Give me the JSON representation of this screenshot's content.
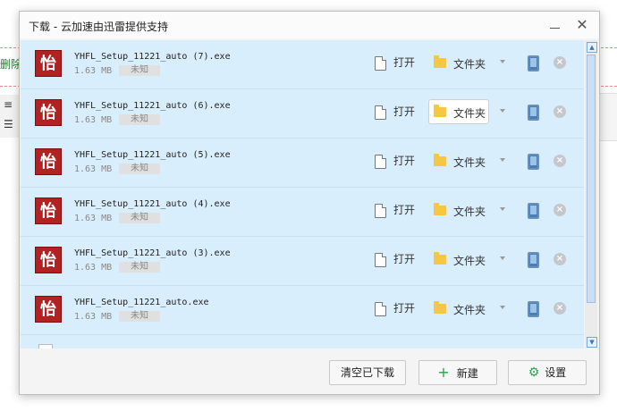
{
  "dialog": {
    "title": "下载 - 云加速由迅雷提供支持"
  },
  "background": {
    "left_label": "删除"
  },
  "downloads": [
    {
      "name": "YHFL_Setup_11221_auto (7).exe",
      "size": "1.63 MB",
      "status": "未知",
      "open": "打开",
      "folder": "文件夹"
    },
    {
      "name": "YHFL_Setup_11221_auto (6).exe",
      "size": "1.63 MB",
      "status": "未知",
      "open": "打开",
      "folder": "文件夹"
    },
    {
      "name": "YHFL_Setup_11221_auto (5).exe",
      "size": "1.63 MB",
      "status": "未知",
      "open": "打开",
      "folder": "文件夹"
    },
    {
      "name": "YHFL_Setup_11221_auto (4).exe",
      "size": "1.63 MB",
      "status": "未知",
      "open": "打开",
      "folder": "文件夹"
    },
    {
      "name": "YHFL_Setup_11221_auto (3).exe",
      "size": "1.63 MB",
      "status": "未知",
      "open": "打开",
      "folder": "文件夹"
    },
    {
      "name": "YHFL_Setup_11221_auto.exe",
      "size": "1.63 MB",
      "status": "未知",
      "open": "打开",
      "folder": "文件夹"
    }
  ],
  "app_icon_glyph": "怡",
  "footer": {
    "clear": "清空已下载",
    "new": "新建",
    "settings": "设置"
  },
  "icons": [
    "file-icon",
    "folder-icon",
    "chevron-down-icon",
    "phone-icon",
    "delete-icon",
    "minimize-icon",
    "close-icon",
    "plus-icon",
    "gear-icon"
  ],
  "colors": {
    "row_bg": "#d9eefc",
    "accent_green": "#2aa24a",
    "app_icon_red": "#b22222",
    "folder_yellow": "#f6c744"
  }
}
